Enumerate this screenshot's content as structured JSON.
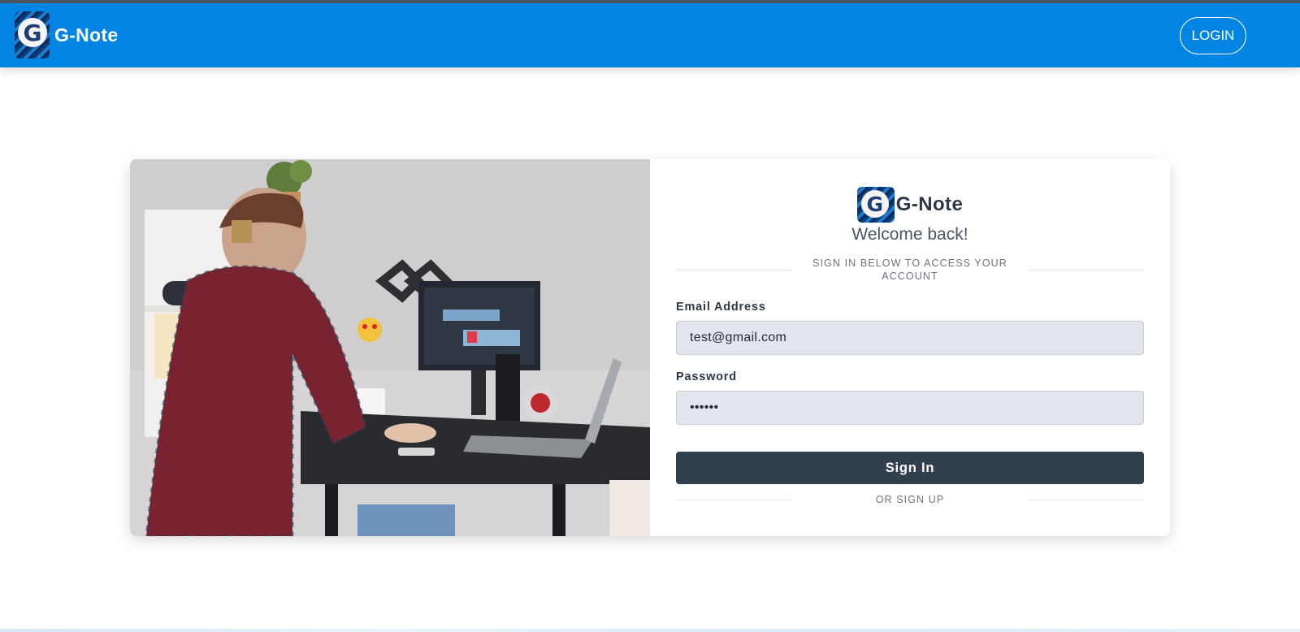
{
  "navbar": {
    "brand_name": "G-Note",
    "logo_letter": "G",
    "login_label": "LOGIN"
  },
  "form": {
    "brand_name": "G-Note",
    "logo_letter": "G",
    "welcome": "Welcome back!",
    "subtitle": "SIGN IN BELOW TO ACCESS YOUR ACCOUNT",
    "email_label": "Email Address",
    "email_value": "test@gmail.com",
    "password_label": "Password",
    "password_value": "••••••",
    "signin_label": "Sign In",
    "signup_label": "OR SIGN UP"
  },
  "colors": {
    "navbar": "#0184e2",
    "button": "#323f4f",
    "input_bg": "#e2e6ec"
  },
  "illustration": {
    "subject": "person-at-desk-photo"
  }
}
